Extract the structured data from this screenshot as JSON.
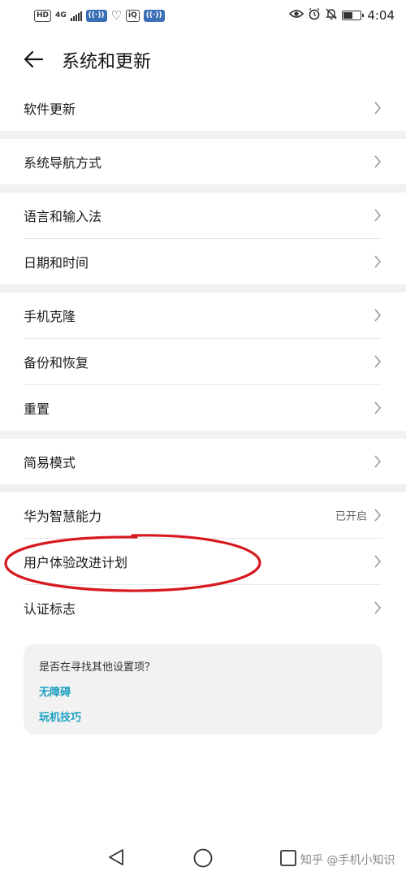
{
  "status_bar": {
    "hd": "HD",
    "net_top": "4G",
    "net_bottom": "⁴⁶",
    "time": "4:04",
    "icons": [
      "eye-icon",
      "alarm-icon",
      "bell-off-icon",
      "battery-icon"
    ],
    "battery_level": 0.55
  },
  "header": {
    "title": "系统和更新",
    "back_icon": "arrow-left-icon"
  },
  "groups": [
    {
      "items": [
        {
          "label": "软件更新"
        }
      ]
    },
    {
      "items": [
        {
          "label": "系统导航方式"
        }
      ]
    },
    {
      "items": [
        {
          "label": "语言和输入法"
        },
        {
          "label": "日期和时间"
        }
      ]
    },
    {
      "items": [
        {
          "label": "手机克隆"
        },
        {
          "label": "备份和恢复"
        },
        {
          "label": "重置"
        }
      ]
    },
    {
      "items": [
        {
          "label": "简易模式"
        }
      ]
    },
    {
      "items": [
        {
          "label": "华为智慧能力",
          "value": "已开启"
        },
        {
          "label": "用户体验改进计划"
        },
        {
          "label": "认证标志"
        }
      ]
    }
  ],
  "help": {
    "title": "是否在寻找其他设置项？",
    "links": [
      "无障碍",
      "玩机技巧"
    ]
  },
  "colors": {
    "link": "#1a9fc0",
    "annotation": "#d7191f",
    "separator": "#f1f1f1"
  },
  "watermark": "知乎 @手机小知识"
}
